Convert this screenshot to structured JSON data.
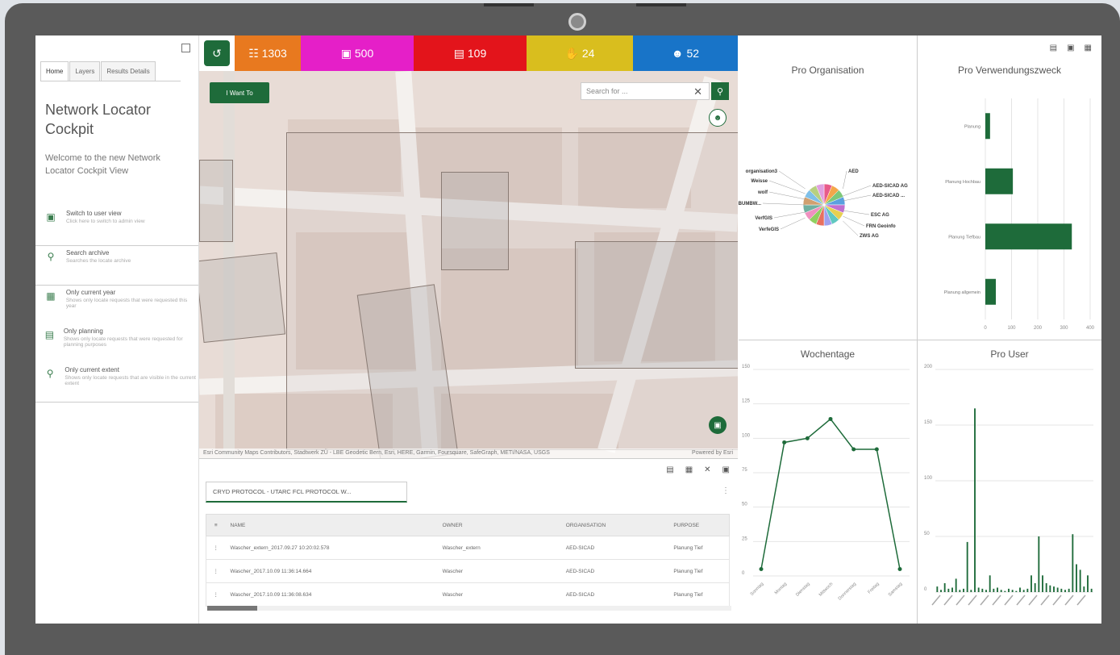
{
  "left_panel": {
    "tabs": [
      "Home",
      "Layers",
      "Results Details"
    ],
    "title": "Network Locator Cockpit",
    "welcome": "Welcome to the new Network Locator Cockpit View",
    "menu": [
      {
        "icon": "grid-switch-icon",
        "label": "Switch to user view",
        "desc": "Click here to switch to admin view"
      },
      {
        "icon": "search-archive-icon",
        "label": "Search archive",
        "desc": "Searches the locate archive"
      },
      {
        "icon": "calendar-icon",
        "label": "Only current year",
        "desc": "Shows only locate requests that were requested this year"
      },
      {
        "icon": "document-icon",
        "label": "Only planning",
        "desc": "Shows only locate requests that were requested for planning purposes"
      },
      {
        "icon": "zoom-extent-icon",
        "label": "Only current extent",
        "desc": "Shows only locate requests that are visible in the current extent"
      }
    ]
  },
  "stats": [
    {
      "value": "1303",
      "icon": "requests-icon",
      "color": "#e8791f"
    },
    {
      "value": "500",
      "icon": "area-icon",
      "color": "#e51fc8"
    },
    {
      "value": "109",
      "icon": "document-stack-icon",
      "color": "#e3141b"
    },
    {
      "value": "24",
      "icon": "hand-icon",
      "color": "#d9be1e"
    },
    {
      "value": "52",
      "icon": "users-icon",
      "color": "#1874c8"
    }
  ],
  "map": {
    "i_want_to": "I Want To",
    "search_placeholder": "Search for ...",
    "attribution": "Esri Community Maps Contributors, Stadtwerk ZÜ - LBE Geodetic Bern, Esri, HERE, Garmin, Foursquare, SafeGraph, METI/NASA, USGS",
    "powered_by": "Powered by Esri"
  },
  "table": {
    "tab_label": "CRYD PROTOCOL - UTARC FCL PROTOCOL W...",
    "headers": [
      "NAME",
      "OWNER",
      "ORGANISATION",
      "PURPOSE"
    ],
    "rows": [
      [
        "Wascher_extern_2017.09.27 10:20:02.578",
        "Wascher_extern",
        "AED-SICAD",
        "Planung Tief"
      ],
      [
        "Wascher_2017.10.09 11:36:14.664",
        "Wascher",
        "AED-SICAD",
        "Planung Tief"
      ],
      [
        "Wascher_2017.10.09 11:36:08.634",
        "Wascher",
        "AED-SICAD",
        "Planung Tief"
      ]
    ]
  },
  "chart_data": [
    {
      "type": "pie",
      "title": "Pro Organisation",
      "labels": [
        "organisation3",
        "AED",
        "Weisse",
        "AED-SICAD AG",
        "AED-SICAD ...",
        "wolf",
        "WEBUMBW...",
        "ESC AG",
        "VerfGIS",
        "FRN Geoinfo",
        "VerfeGIS",
        "ZWS AG"
      ]
    },
    {
      "type": "bar",
      "title": "Pro Verwendungszweck",
      "categories": [
        "Planung",
        "Planung Hochbau",
        "Planung Tiefbau",
        "Planung allgemein"
      ],
      "values": [
        18,
        105,
        330,
        40
      ],
      "xlim": [
        0,
        400
      ],
      "xticks": [
        "0",
        "100",
        "200",
        "300",
        "400"
      ]
    },
    {
      "type": "line",
      "title": "Wochentage",
      "categories": [
        "Sonntag",
        "Montag",
        "Dienstag",
        "Mittwoch",
        "Donnerstag",
        "Freitag",
        "Samstag"
      ],
      "values": [
        5,
        97,
        100,
        114,
        92,
        92,
        5
      ],
      "ylim": [
        0,
        150
      ],
      "yticks": [
        "0",
        "25",
        "50",
        "75",
        "100",
        "125",
        "150"
      ]
    },
    {
      "type": "bar",
      "title": "Pro User",
      "values": [
        5,
        2,
        8,
        3,
        4,
        12,
        2,
        3,
        45,
        2,
        165,
        4,
        3,
        2,
        15,
        3,
        4,
        2,
        1,
        3,
        2,
        1,
        4,
        2,
        3,
        15,
        8,
        50,
        15,
        8,
        6,
        5,
        4,
        3,
        2,
        3,
        52,
        25,
        20,
        5,
        15,
        3
      ],
      "ylim": [
        0,
        200
      ],
      "yticks": [
        "0",
        "50",
        "100",
        "150",
        "200"
      ]
    }
  ]
}
